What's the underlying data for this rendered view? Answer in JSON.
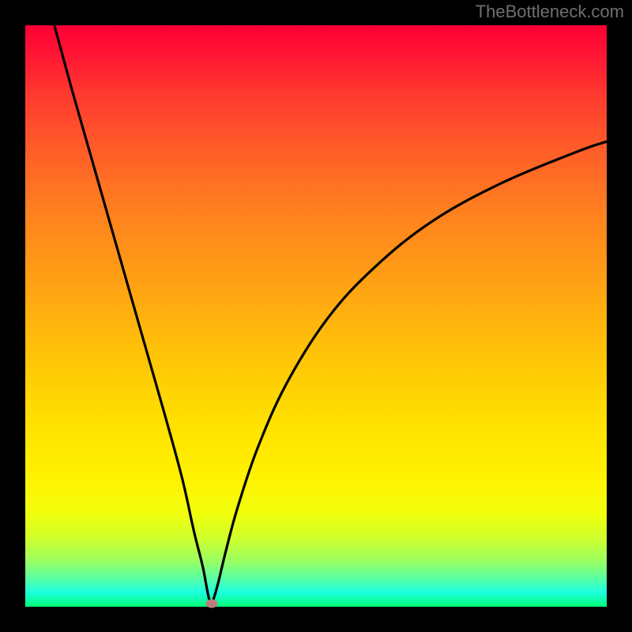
{
  "watermark": "TheBottleneck.com",
  "chart_data": {
    "type": "line",
    "title": "",
    "xlabel": "",
    "ylabel": "",
    "xlim": [
      0,
      100
    ],
    "ylim": [
      0,
      100
    ],
    "grid": false,
    "legend": false,
    "series": [
      {
        "name": "curve",
        "x": [
          5,
          8,
          12,
          16,
          20,
          24,
          27,
          29,
          30.5,
          31.2,
          31.6,
          32,
          32.4,
          33.2,
          34.5,
          36.5,
          40,
          45,
          52,
          60,
          70,
          82,
          95,
          100
        ],
        "y": [
          100,
          89,
          75,
          61,
          47,
          33,
          22,
          13,
          7,
          3.3,
          1.4,
          0.5,
          1.4,
          4.2,
          9.6,
          17,
          27.4,
          38.5,
          49.6,
          58.3,
          66.3,
          72.9,
          78.3,
          80
        ]
      }
    ],
    "marker": {
      "x": 32,
      "y": 0.6
    }
  }
}
